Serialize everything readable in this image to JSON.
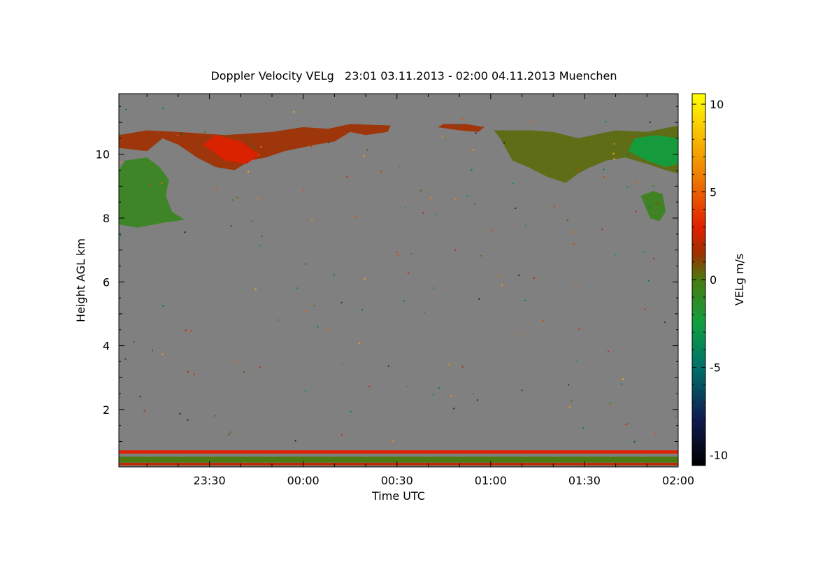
{
  "chart_data": {
    "type": "heatmap",
    "title": "Doppler Velocity VELg   23:01 03.11.2013 - 02:00 04.11.2013 Muenchen",
    "xlabel": "Time UTC",
    "ylabel": "Height AGL km",
    "colorbar_label": "VELg m/s",
    "xlim_minutes_after_midnight": [
      -59,
      120
    ],
    "ylim": [
      0.2,
      11.9
    ],
    "clim": [
      -10.6,
      10.6
    ],
    "x_ticks": [
      {
        "minute": -30,
        "label": "23:30"
      },
      {
        "minute": 0,
        "label": "00:00"
      },
      {
        "minute": 30,
        "label": "00:30"
      },
      {
        "minute": 60,
        "label": "01:00"
      },
      {
        "minute": 90,
        "label": "01:30"
      },
      {
        "minute": 120,
        "label": "02:00"
      }
    ],
    "y_ticks": [
      {
        "value": 2,
        "label": "2"
      },
      {
        "value": 4,
        "label": "4"
      },
      {
        "value": 6,
        "label": "6"
      },
      {
        "value": 8,
        "label": "8"
      },
      {
        "value": 10,
        "label": "10"
      }
    ],
    "colorbar_ticks": [
      {
        "value": 10,
        "label": "10"
      },
      {
        "value": 5,
        "label": "5"
      },
      {
        "value": 0,
        "label": "0"
      },
      {
        "value": -5,
        "label": "-5"
      },
      {
        "value": -10,
        "label": "-10"
      }
    ],
    "background_color": "#808080",
    "colormap": [
      {
        "value": -10.6,
        "color": "#000000"
      },
      {
        "value": -8,
        "color": "#101a50"
      },
      {
        "value": -5,
        "color": "#00706a"
      },
      {
        "value": -2.5,
        "color": "#10a040"
      },
      {
        "value": 0,
        "color": "#4a7a10"
      },
      {
        "value": 1.5,
        "color": "#a03000"
      },
      {
        "value": 3,
        "color": "#e02000"
      },
      {
        "value": 6,
        "color": "#f08000"
      },
      {
        "value": 10.6,
        "color": "#ffff00"
      }
    ],
    "regions": [
      {
        "name": "upper cloud band west",
        "points": [
          [
            -59,
            10.2
          ],
          [
            -50,
            10.1
          ],
          [
            -45,
            10.5
          ],
          [
            -40,
            10.3
          ],
          [
            -34,
            9.9
          ],
          [
            -28,
            9.6
          ],
          [
            -22,
            9.5
          ],
          [
            -17,
            9.8
          ],
          [
            -12,
            9.9
          ],
          [
            -6,
            10.1
          ],
          [
            -1,
            10.2
          ],
          [
            4,
            10.3
          ],
          [
            10,
            10.4
          ],
          [
            15,
            10.7
          ],
          [
            20,
            10.6
          ],
          [
            27,
            10.7
          ],
          [
            28,
            10.9
          ],
          [
            15,
            10.95
          ],
          [
            8,
            10.8
          ],
          [
            0,
            10.85
          ],
          [
            -10,
            10.7
          ],
          [
            -25,
            10.6
          ],
          [
            -40,
            10.7
          ],
          [
            -50,
            10.75
          ],
          [
            -59,
            10.6
          ]
        ],
        "velocity": 1.5
      },
      {
        "name": "upper cloud core",
        "points": [
          [
            -32,
            10.3
          ],
          [
            -25,
            9.8
          ],
          [
            -18,
            9.7
          ],
          [
            -14,
            10.0
          ],
          [
            -20,
            10.4
          ],
          [
            -28,
            10.6
          ]
        ],
        "velocity": 3.0
      },
      {
        "name": "left cloud mass",
        "points": [
          [
            -59,
            9.5
          ],
          [
            -57,
            9.8
          ],
          [
            -50,
            9.9
          ],
          [
            -46,
            9.6
          ],
          [
            -43,
            9.2
          ],
          [
            -44,
            8.7
          ],
          [
            -42,
            8.2
          ],
          [
            -38,
            7.95
          ],
          [
            -45,
            7.85
          ],
          [
            -53,
            7.7
          ],
          [
            -59,
            7.8
          ]
        ],
        "velocity": -0.8
      },
      {
        "name": "upper cloud band east",
        "points": [
          [
            61,
            10.75
          ],
          [
            63,
            10.5
          ],
          [
            67,
            9.8
          ],
          [
            72,
            9.6
          ],
          [
            78,
            9.3
          ],
          [
            84,
            9.1
          ],
          [
            88,
            9.4
          ],
          [
            92,
            9.6
          ],
          [
            97,
            9.8
          ],
          [
            103,
            9.9
          ],
          [
            110,
            9.7
          ],
          [
            116,
            9.5
          ],
          [
            120,
            9.4
          ],
          [
            120,
            10.9
          ],
          [
            110,
            10.7
          ],
          [
            100,
            10.75
          ],
          [
            95,
            10.65
          ],
          [
            88,
            10.5
          ],
          [
            80,
            10.7
          ],
          [
            73,
            10.75
          ]
        ],
        "velocity": 0.3
      },
      {
        "name": "east negative core",
        "points": [
          [
            104,
            10.1
          ],
          [
            110,
            9.8
          ],
          [
            116,
            9.6
          ],
          [
            120,
            9.7
          ],
          [
            120,
            10.5
          ],
          [
            113,
            10.6
          ],
          [
            106,
            10.5
          ]
        ],
        "velocity": -2.5
      },
      {
        "name": "small mid cloud",
        "points": [
          [
            43,
            10.85
          ],
          [
            50,
            10.75
          ],
          [
            56,
            10.7
          ],
          [
            58,
            10.85
          ],
          [
            52,
            10.95
          ],
          [
            45,
            10.95
          ]
        ],
        "velocity": 1.6
      },
      {
        "name": "east cloud blob",
        "points": [
          [
            108,
            8.7
          ],
          [
            111,
            8.0
          ],
          [
            114,
            7.9
          ],
          [
            116,
            8.2
          ],
          [
            115,
            8.75
          ],
          [
            112,
            8.85
          ]
        ],
        "velocity": -0.6
      }
    ],
    "surface_bands": [
      {
        "y0": 0.62,
        "y1": 0.72,
        "velocity": 3.0
      },
      {
        "y0": 0.34,
        "y1": 0.52,
        "velocity": 0.0
      },
      {
        "y0": 0.25,
        "y1": 0.33,
        "velocity": 2.2
      }
    ]
  }
}
